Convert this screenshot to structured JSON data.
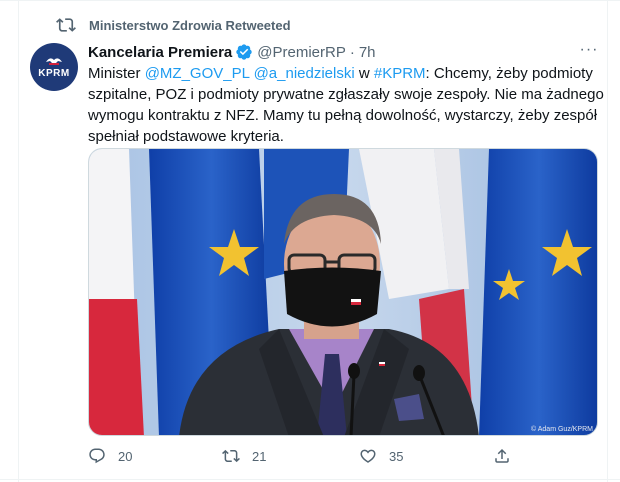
{
  "retweet": {
    "label": "Ministerstwo Zdrowia Retweeted",
    "icon": "retweet-icon"
  },
  "author": {
    "avatar_text": "KPRM",
    "name": "Kancelaria Premiera",
    "verified_icon": "verified-badge-icon",
    "handle": "@PremierRP",
    "separator": "·",
    "time": "7h"
  },
  "more_icon": "more-options-icon",
  "more_label": "···",
  "text": {
    "part1": "Minister ",
    "mention1": "@MZ_GOV_PL",
    "space1": " ",
    "mention2": "@a_niedzielski",
    "part2": " w ",
    "hashtag": "#KPRM",
    "part3": ": Chcemy, żeby podmioty szpitalne, POZ i podmioty prywatne zgłaszały swoje zespoły. Nie ma żadnego wymogu kontraktu z NFZ. Mamy tu pełną dowolność, wystarczy, żeby zespół spełniał podstawowe kryteria."
  },
  "media": {
    "credit": "© Adam Guz/KPRM"
  },
  "actions": {
    "reply": {
      "icon": "reply-icon",
      "count": "20"
    },
    "retweet": {
      "icon": "retweet-action-icon",
      "count": "21"
    },
    "like": {
      "icon": "like-icon",
      "count": "35"
    },
    "share": {
      "icon": "share-icon"
    }
  },
  "colors": {
    "link": "#1d9bf0",
    "muted": "#536471",
    "verified": "#1d9bf0",
    "avatar_bg": "#1f3a78"
  }
}
